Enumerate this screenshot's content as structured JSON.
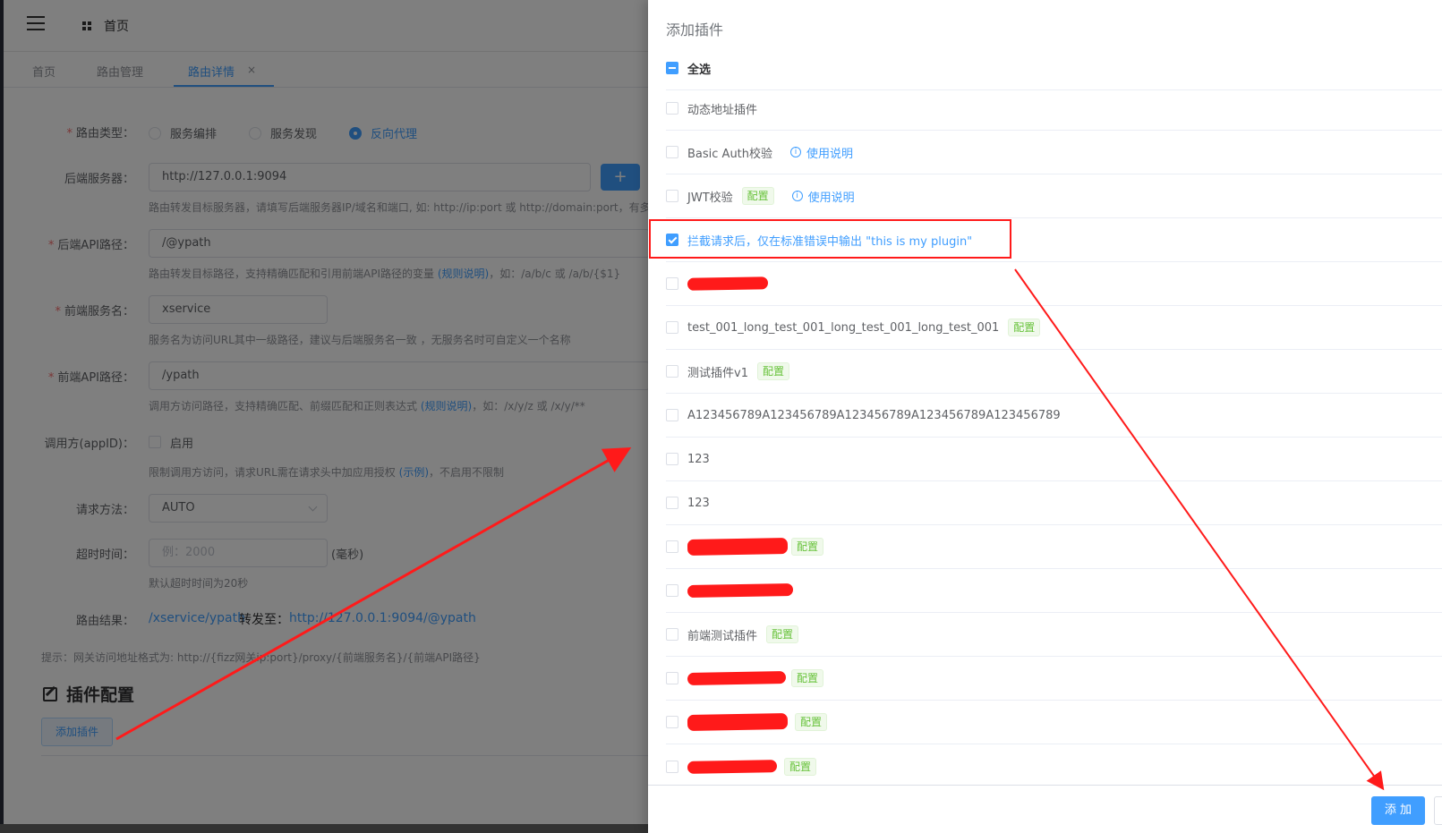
{
  "topbar": {
    "home_label": "首页"
  },
  "tabs": [
    {
      "label": "首页"
    },
    {
      "label": "路由管理"
    },
    {
      "label": "路由详情",
      "close": "×"
    }
  ],
  "form": {
    "route_type": {
      "label": "路由类型：",
      "options": [
        "服务编排",
        "服务发现",
        "反向代理"
      ],
      "selected": "反向代理"
    },
    "backend_server": {
      "label": "后端服务器：",
      "value": "http://127.0.0.1:9094",
      "add_button": "+",
      "help": "路由转发目标服务器，请填写后端服务器IP/域名和端口, 如: http://ip:port 或 http://domain:port，有多台服"
    },
    "backend_api_path": {
      "label": "后端API路径：",
      "value": "/@ypath",
      "help_prefix": "路由转发目标路径，支持精确匹配和引用前端API路径的变量",
      "help_link": "(规则说明)",
      "help_suffix": "，如：/a/b/c 或 /a/b/{$1}"
    },
    "frontend_service": {
      "label": "前端服务名：",
      "value": "xservice",
      "help": "服务名为访问URL其中一级路径，建议与后端服务名一致 ，无服务名时可自定义一个名称"
    },
    "frontend_api_path": {
      "label": "前端API路径：",
      "value": "/ypath",
      "help_prefix": "调用方访问路径，支持精确匹配、前缀匹配和正则表达式",
      "help_link": "(规则说明)",
      "help_suffix": "，如：/x/y/z 或 /x/y/**"
    },
    "caller": {
      "label": "调用方(appID)：",
      "checkbox_label": "启用",
      "help_prefix": "限制调用方访问，请求URL需在请求头中加应用授权",
      "help_link": "(示例)",
      "help_suffix": "，不启用不限制"
    },
    "method": {
      "label": "请求方法：",
      "value": "AUTO"
    },
    "timeout": {
      "label": "超时时间：",
      "placeholder": "例：2000",
      "unit": "(毫秒)",
      "help": "默认超时时间为20秒"
    },
    "result": {
      "label": "路由结果：",
      "from": "/xservice/ypath",
      "mid": "转发至：",
      "to": "http://127.0.0.1:9094/@ypath"
    },
    "hint": "提示：网关访问地址格式为: http://{fizz网关ip:port}/proxy/{前端服务名}/{前端API路径}"
  },
  "plugin_section": {
    "title": "插件配置",
    "add_button": "添加插件"
  },
  "drawer": {
    "title": "添加插件",
    "select_all": "全选",
    "items": [
      {
        "name": "动态地址插件"
      },
      {
        "name": "Basic Auth校验",
        "usage": "使用说明"
      },
      {
        "name": "JWT校验",
        "tag": "配置",
        "usage": "使用说明"
      },
      {
        "name": "拦截请求后，仅在标准错误中输出 \"this is my plugin\"",
        "checked": true
      },
      {
        "name": ""
      },
      {
        "name": "test_001_long_test_001_long_test_001_long_test_001",
        "tag": "配置"
      },
      {
        "name": "测试插件v1",
        "tag": "配置"
      },
      {
        "name": "A123456789A123456789A123456789A123456789A123456789"
      },
      {
        "name": "123"
      },
      {
        "name": "123"
      },
      {
        "name": "",
        "tag": "配置"
      },
      {
        "name": ""
      },
      {
        "name": "前端测试插件",
        "tag": "配置"
      },
      {
        "name": "",
        "tag": "配置"
      },
      {
        "name": "",
        "tag": "配置"
      },
      {
        "name": "",
        "tag": "配置"
      }
    ],
    "add_button": "添 加"
  }
}
